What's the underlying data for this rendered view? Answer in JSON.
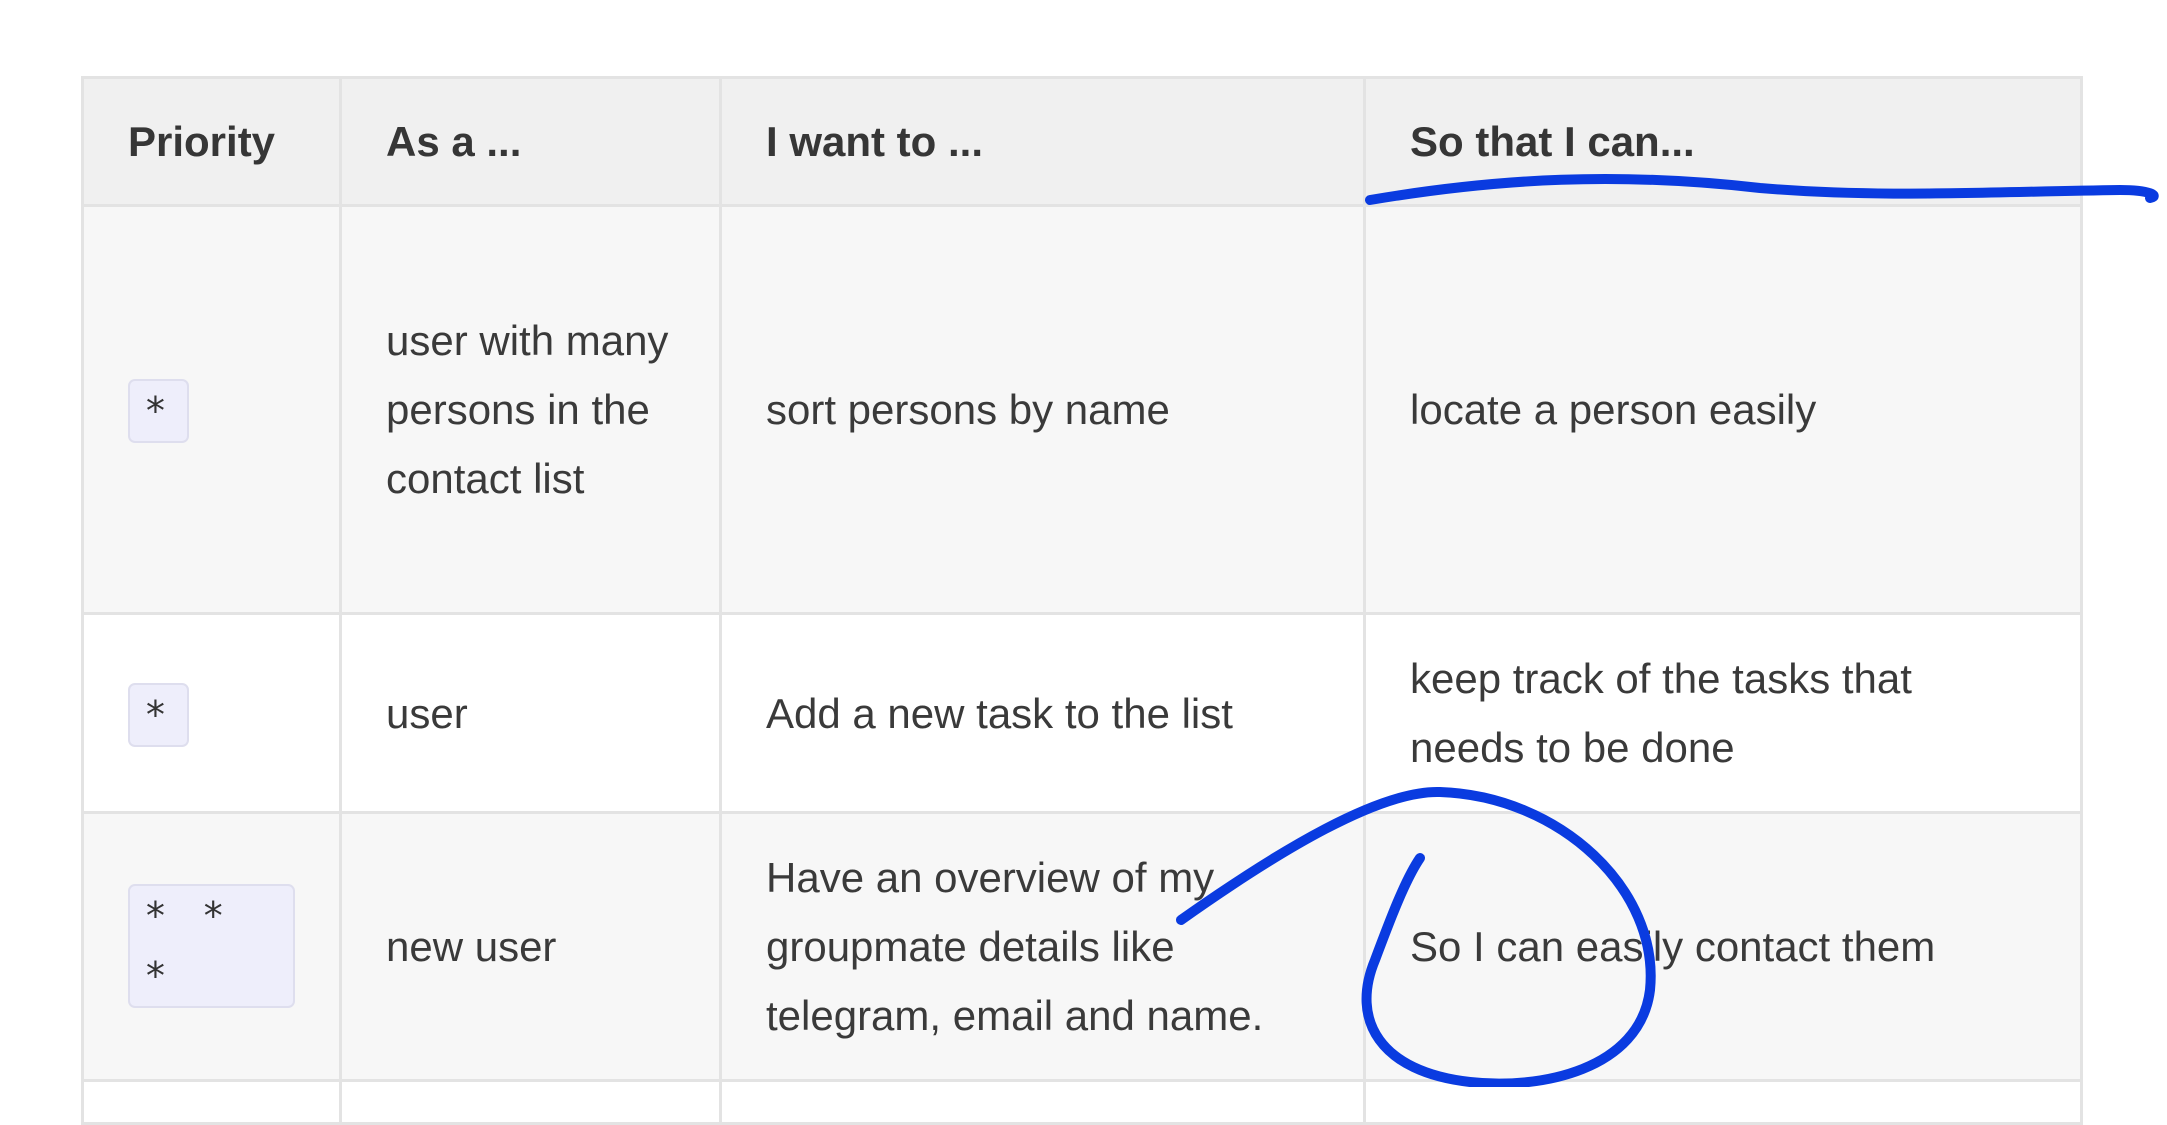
{
  "table": {
    "headers": [
      "Priority",
      "As a ...",
      "I want to ...",
      "So that I can..."
    ],
    "rows": [
      {
        "priority": "* ",
        "as_a": "user with many persons in the contact list",
        "want": "sort persons by name",
        "so_that": "locate a person easily"
      },
      {
        "priority": "*",
        "as_a": "user",
        "want": "Add a new task to the list",
        "so_that": "keep track of the tasks that needs to be done"
      },
      {
        "priority": "* * *",
        "as_a": "new user",
        "want": "Have an overview of my groupmate details like telegram, email and name.",
        "so_that": "So I can easily contact them"
      }
    ]
  },
  "annotation": {
    "color": "#0a3be0"
  }
}
